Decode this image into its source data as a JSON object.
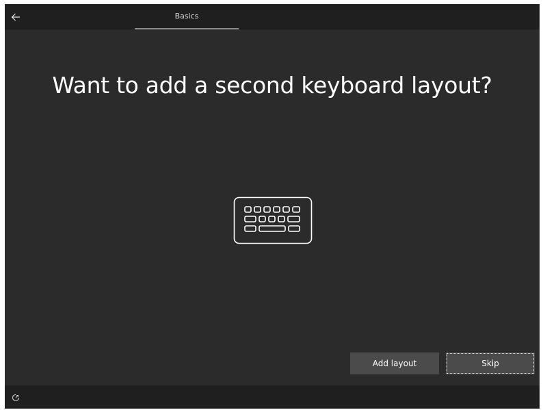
{
  "window": {
    "tab_label": "Basics"
  },
  "main": {
    "heading": "Want to add a second keyboard layout?"
  },
  "buttons": {
    "add_layout": "Add layout",
    "skip": "Skip"
  },
  "icons": {
    "back": "arrow-left-icon",
    "illustration": "keyboard-icon",
    "accessibility": "ease-of-access-icon"
  },
  "colors": {
    "background": "#2b2b2b",
    "bar": "#1f1f1f",
    "button": "#4b4b4b",
    "text": "#ffffff",
    "tab_underline": "#8c8c8c"
  }
}
